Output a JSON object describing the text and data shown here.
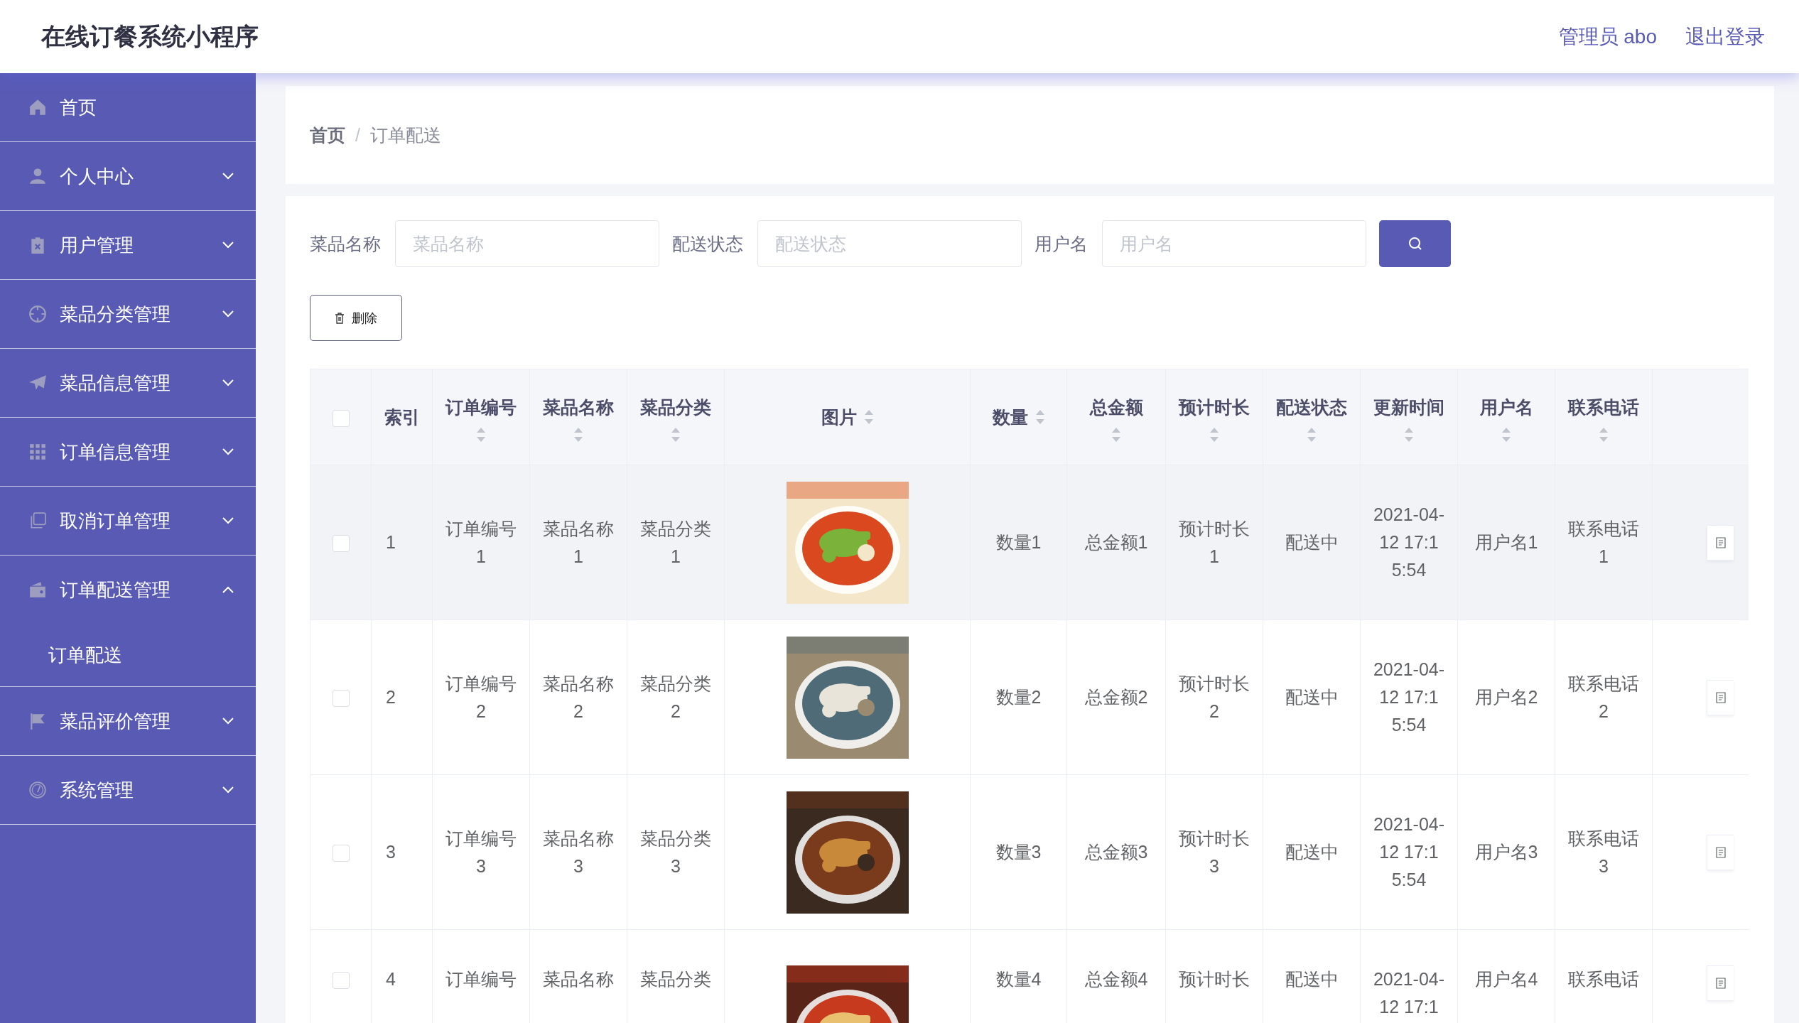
{
  "app": {
    "title": "在线订餐系统小程序",
    "user": "管理员 abo",
    "logout": "退出登录"
  },
  "sidebar": {
    "items": [
      {
        "label": "首页",
        "kind": "link"
      },
      {
        "label": "个人中心",
        "kind": "menu",
        "expanded": false
      },
      {
        "label": "用户管理",
        "kind": "menu",
        "expanded": false
      },
      {
        "label": "菜品分类管理",
        "kind": "menu",
        "expanded": false
      },
      {
        "label": "菜品信息管理",
        "kind": "menu",
        "expanded": false
      },
      {
        "label": "订单信息管理",
        "kind": "menu",
        "expanded": false
      },
      {
        "label": "取消订单管理",
        "kind": "menu",
        "expanded": false
      },
      {
        "label": "订单配送管理",
        "kind": "menu",
        "expanded": true,
        "children": [
          {
            "label": "订单配送"
          }
        ]
      },
      {
        "label": "菜品评价管理",
        "kind": "menu",
        "expanded": false
      },
      {
        "label": "系统管理",
        "kind": "menu",
        "expanded": false
      }
    ]
  },
  "breadcrumb": {
    "items": [
      "首页",
      "订单配送"
    ],
    "separator": "/"
  },
  "search": {
    "fields": [
      {
        "label": "菜品名称",
        "placeholder": "菜品名称"
      },
      {
        "label": "配送状态",
        "placeholder": "配送状态"
      },
      {
        "label": "用户名",
        "placeholder": "用户名"
      }
    ]
  },
  "toolbar": {
    "delete_button": "删除"
  },
  "table": {
    "header_checked": false,
    "columns": [
      {
        "label": "索引",
        "kind": "plain"
      },
      {
        "label": "订单编号",
        "kind": "stacked"
      },
      {
        "label": "菜品名称",
        "kind": "stacked"
      },
      {
        "label": "菜品分类",
        "kind": "stacked"
      },
      {
        "label": "图片",
        "kind": "inline"
      },
      {
        "label": "数量",
        "kind": "inline"
      },
      {
        "label": "总金额",
        "kind": "stacked"
      },
      {
        "label": "预计时长",
        "kind": "stacked"
      },
      {
        "label": "配送状态",
        "kind": "stacked"
      },
      {
        "label": "更新时间",
        "kind": "stacked"
      },
      {
        "label": "用户名",
        "kind": "stacked"
      },
      {
        "label": "联系电话",
        "kind": "stacked"
      }
    ],
    "rows": [
      {
        "checked": false,
        "highlighted": true,
        "index": "1",
        "order_no": "订单编号1",
        "dish_name": "菜品名称1",
        "category": "菜品分类1",
        "quantity": "数量1",
        "total": "总金额1",
        "duration": "预计时长1",
        "status": "配送中",
        "updated": "2021-04-12 17:15:54",
        "username": "用户名1",
        "phone": "联系电话1"
      },
      {
        "checked": false,
        "highlighted": false,
        "index": "2",
        "order_no": "订单编号2",
        "dish_name": "菜品名称2",
        "category": "菜品分类2",
        "quantity": "数量2",
        "total": "总金额2",
        "duration": "预计时长2",
        "status": "配送中",
        "updated": "2021-04-12 17:15:54",
        "username": "用户名2",
        "phone": "联系电话2"
      },
      {
        "checked": false,
        "highlighted": false,
        "index": "3",
        "order_no": "订单编号3",
        "dish_name": "菜品名称3",
        "category": "菜品分类3",
        "quantity": "数量3",
        "total": "总金额3",
        "duration": "预计时长3",
        "status": "配送中",
        "updated": "2021-04-12 17:15:54",
        "username": "用户名3",
        "phone": "联系电话3"
      },
      {
        "checked": false,
        "highlighted": false,
        "index": "4",
        "order_no": "订单编号",
        "dish_name": "菜品名称",
        "category": "菜品分类",
        "quantity": "数量4",
        "total": "总金额4",
        "duration": "预计时长",
        "status": "配送中",
        "updated": "2021-04-12 17:1",
        "username": "用户名4",
        "phone": "联系电话"
      }
    ]
  }
}
